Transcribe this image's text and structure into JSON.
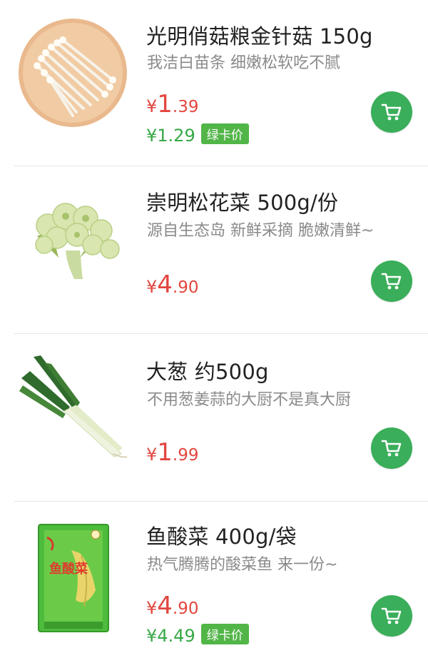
{
  "products": [
    {
      "name": "光明俏菇粮金针菇 150g",
      "desc": "我洁白苗条 细嫩松软吃不腻",
      "price_currency": "¥",
      "price_int": "1",
      "price_dec": ".39",
      "member_price": "¥1.29",
      "member_badge": "绿卡价",
      "image_icon": "enoki-mushroom-image"
    },
    {
      "name": "崇明松花菜 500g/份",
      "desc": "源自生态岛 新鲜采摘 脆嫩清鲜~",
      "price_currency": "¥",
      "price_int": "4",
      "price_dec": ".90",
      "image_icon": "cauliflower-image"
    },
    {
      "name": "大葱 约500g",
      "desc": "不用葱姜蒜的大厨不是真大厨",
      "price_currency": "¥",
      "price_int": "1",
      "price_dec": ".99",
      "image_icon": "scallion-image"
    },
    {
      "name": "鱼酸菜 400g/袋",
      "desc": "热气腾腾的酸菜鱼 来一份~",
      "price_currency": "¥",
      "price_int": "4",
      "price_dec": ".90",
      "member_price": "¥4.49",
      "member_badge": "绿卡价",
      "image_icon": "pickled-cabbage-bag-image",
      "package_text": "鱼酸菜"
    }
  ],
  "colors": {
    "price_red": "#e2463f",
    "member_green": "#36a845",
    "cart_green": "#3aae5a"
  },
  "cart_icon": "shopping-cart-icon"
}
